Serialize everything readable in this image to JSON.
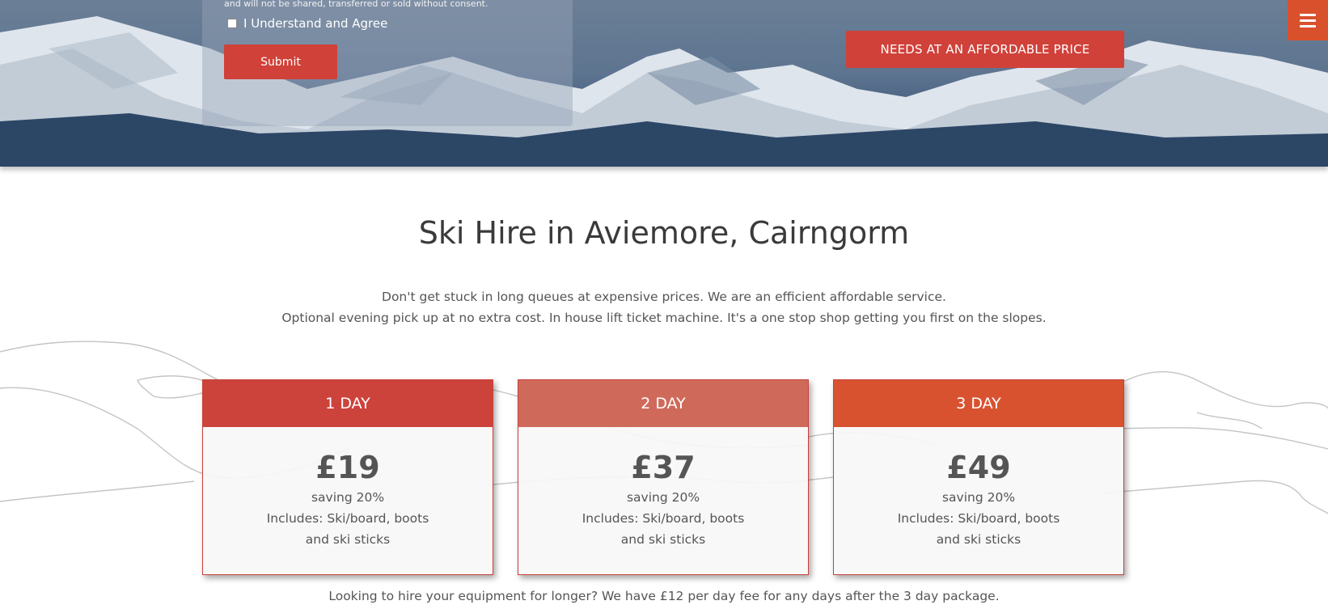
{
  "hero": {
    "form_note": "and will not be shared, transferred or sold without consent.",
    "agree_label": "I Understand and Agree",
    "submit_label": "Submit",
    "cta_label": "NEEDS AT AN AFFORDABLE PRICE",
    "menu_icon": "hamburger-menu-icon"
  },
  "section": {
    "title": "Ski Hire in Aviemore, Cairngorm",
    "intro_line_1": "Don't get stuck in long queues at expensive prices. We are an efficient affordable service.",
    "intro_line_2": "Optional evening pick up at no extra cost. In house lift ticket machine. It's a one stop shop getting you first on the slopes."
  },
  "pricing": [
    {
      "label": "1 DAY",
      "price": "£19",
      "saving": "saving 20%",
      "includes_1": "Includes: Ski/board, boots",
      "includes_2": "and ski sticks",
      "color": "#cc433c"
    },
    {
      "label": "2 DAY",
      "price": "£37",
      "saving": "saving 20%",
      "includes_1": "Includes: Ski/board, boots",
      "includes_2": "and ski sticks",
      "color": "#cf6a5a"
    },
    {
      "label": "3 DAY",
      "price": "£49",
      "saving": "saving 20%",
      "includes_1": "Includes: Ski/board, boots",
      "includes_2": "and ski sticks",
      "color": "#d95230"
    }
  ],
  "footer_note": "Looking to hire your equipment for longer? We have £12 per day fee for any days after the 3 day package.",
  "colors": {
    "accent": "#d04139",
    "menu": "#d9512c"
  }
}
